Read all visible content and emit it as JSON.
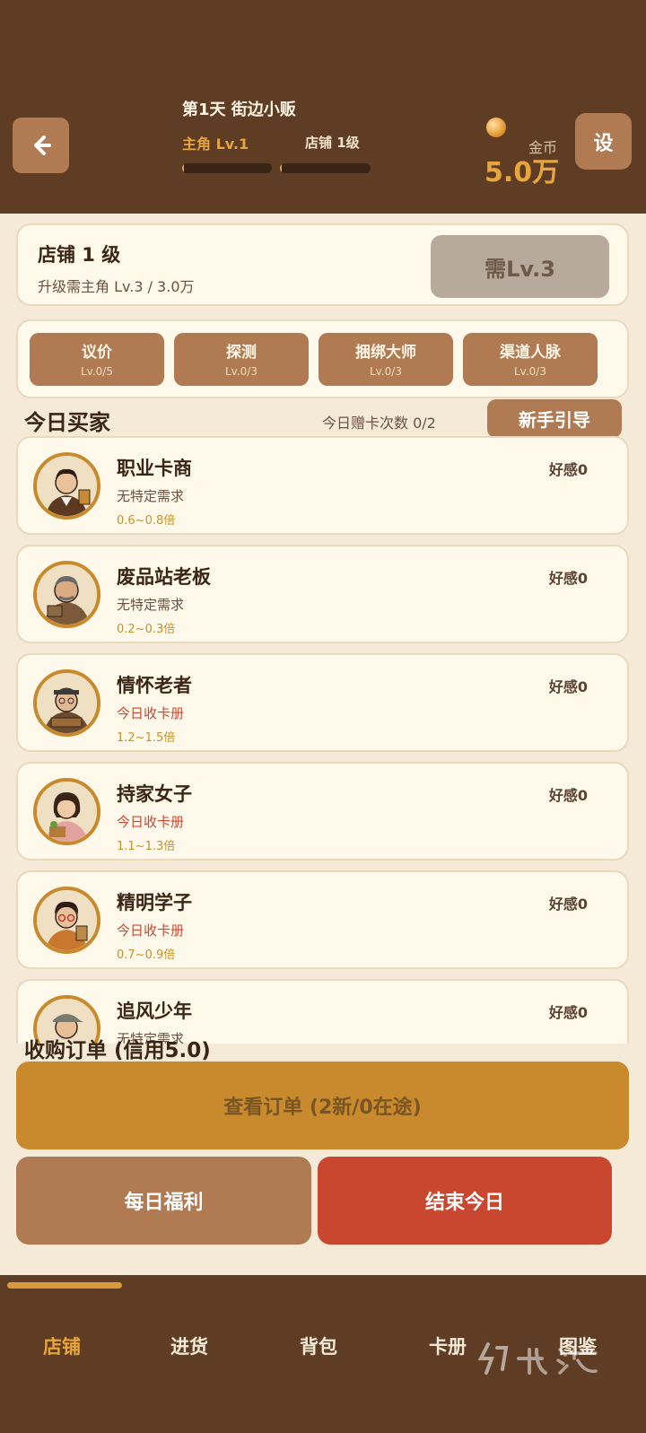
{
  "header": {
    "day_title": "第1天 街边小贩",
    "player_level": "主角 Lv.1",
    "player_progress": 0.02,
    "shop_level": "店铺 1级",
    "shop_progress": 0.02,
    "coin_label": "金币",
    "coin_value": "5.0万",
    "settings_label": "设"
  },
  "shop": {
    "title": "店铺 1 级",
    "requirement": "升级需主角 Lv.3 / 3.0万",
    "need_button": "需Lv.3"
  },
  "skills": [
    {
      "name": "议价",
      "level": "Lv.0/5"
    },
    {
      "name": "探测",
      "level": "Lv.0/3"
    },
    {
      "name": "捆绑大师",
      "level": "Lv.0/3"
    },
    {
      "name": "渠道人脉",
      "level": "Lv.0/3"
    }
  ],
  "buyers_section": {
    "title": "今日买家",
    "gift_count": "今日赠卡次数 0/2",
    "guide_button": "新手引导"
  },
  "buyers": [
    {
      "name": "职业卡商",
      "need": "无特定需求",
      "mult": "0.6~0.8倍",
      "favor": "好感0",
      "need_type": "normal"
    },
    {
      "name": "废品站老板",
      "need": "无特定需求",
      "mult": "0.2~0.3倍",
      "favor": "好感0",
      "need_type": "normal"
    },
    {
      "name": "情怀老者",
      "need": "今日收卡册",
      "mult": "1.2~1.5倍",
      "favor": "好感0",
      "need_type": "red"
    },
    {
      "name": "持家女子",
      "need": "今日收卡册",
      "mult": "1.1~1.3倍",
      "favor": "好感0",
      "need_type": "red"
    },
    {
      "name": "精明学子",
      "need": "今日收卡册",
      "mult": "0.7~0.9倍",
      "favor": "好感0",
      "need_type": "red"
    },
    {
      "name": "追风少年",
      "need": "无特定需求",
      "mult": "",
      "favor": "好感0",
      "need_type": "normal"
    }
  ],
  "orders": {
    "title": "收购订单 (信用5.0)",
    "view_button": "查看订单 (2新/0在途)",
    "welfare_button": "每日福利",
    "end_button": "结束今日"
  },
  "nav": {
    "items": [
      "店铺",
      "进货",
      "背包",
      "卡册",
      "图鉴"
    ],
    "active": "店铺"
  },
  "colors": {
    "header_bg": "#5f3d25",
    "accent": "#e7a63c",
    "button_brown": "#b07a52",
    "order_gold": "#c88a2c",
    "end_red": "#c9472e",
    "page_bg": "#f5ead8"
  }
}
